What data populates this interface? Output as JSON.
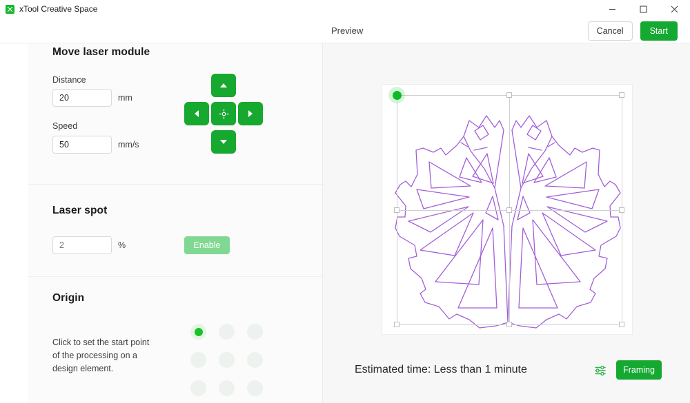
{
  "window": {
    "app_title": "xTool Creative Space",
    "logo_icon": "xtool-logo-icon",
    "minimize_icon": "minimize-icon",
    "maximize_icon": "maximize-icon",
    "close_icon": "close-icon"
  },
  "header": {
    "title": "Preview",
    "cancel_label": "Cancel",
    "start_label": "Start"
  },
  "move_laser": {
    "title": "Move laser module",
    "distance_label": "Distance",
    "distance_value": "20",
    "distance_unit": "mm",
    "speed_label": "Speed",
    "speed_value": "50",
    "speed_unit": "mm/s",
    "dpad": {
      "up_icon": "arrow-up-icon",
      "left_icon": "arrow-left-icon",
      "center_icon": "crosshair-target-icon",
      "right_icon": "arrow-right-icon",
      "down_icon": "arrow-down-icon"
    }
  },
  "laser_spot": {
    "title": "Laser spot",
    "value_placeholder": "2",
    "value": "",
    "unit": "%",
    "enable_label": "Enable",
    "enable_disabled_color": "#81d892"
  },
  "origin": {
    "title": "Origin",
    "description": "Click to set the start point of the processing on a design element.",
    "selected_index": 0,
    "cells": [
      "origin-top-left",
      "origin-top-center",
      "origin-top-right",
      "origin-middle-left",
      "origin-middle-center",
      "origin-middle-right",
      "origin-bottom-left",
      "origin-bottom-center",
      "origin-bottom-right"
    ]
  },
  "preview": {
    "artwork_stroke_color": "#a25ed8",
    "selection_color": "#d0d0d0",
    "origin_marker_color": "#0fbb24",
    "estimated_time": "Estimated time: Less than 1 minute",
    "settings_icon": "sliders-settings-icon",
    "framing_label": "Framing"
  },
  "colors": {
    "brand_green": "#16a932",
    "panel_bg": "#fbfbfb",
    "right_bg": "#f7f7f8"
  }
}
